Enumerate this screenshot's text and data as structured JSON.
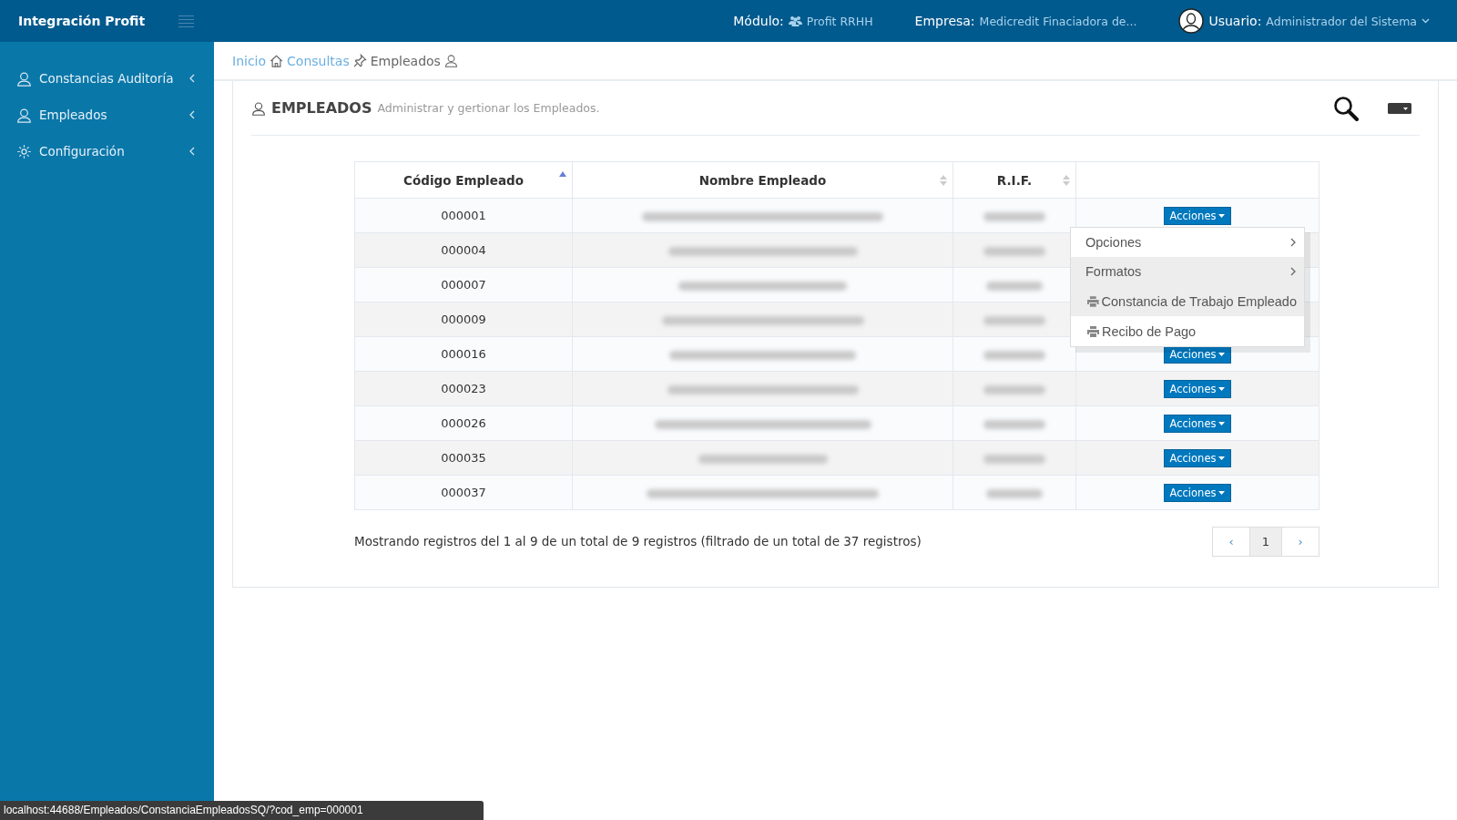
{
  "brand": "Integración Profit",
  "header": {
    "module_label": "Módulo:",
    "module_value": "Profit RRHH",
    "company_label": "Empresa:",
    "company_value": "Medicredit Finaciadora de...",
    "user_label": "Usuario:",
    "user_value": "Administrador del Sistema"
  },
  "sidebar": {
    "items": [
      {
        "label": "Constancias Auditoría",
        "expanded": false
      },
      {
        "label": "Empleados",
        "expanded": false
      },
      {
        "label": "Configuración",
        "expanded": false
      }
    ]
  },
  "breadcrumb": [
    {
      "label": "Inicio",
      "link": true
    },
    {
      "label": "Consultas",
      "link": true
    },
    {
      "label": "Empleados",
      "link": false
    }
  ],
  "panel": {
    "title": "EMPLEADOS",
    "subtitle": "Administrar y gertionar los Empleados."
  },
  "table": {
    "columns": [
      {
        "label": "Código Empleado",
        "sorted": true
      },
      {
        "label": "Nombre Empleado",
        "sorted": false
      },
      {
        "label": "R.I.F.",
        "sorted": false
      }
    ],
    "rows": [
      {
        "code": "000001",
        "actions": "Acciones"
      },
      {
        "code": "000004"
      },
      {
        "code": "000007"
      },
      {
        "code": "000009"
      },
      {
        "code": "000016",
        "actions": "Acciones"
      },
      {
        "code": "000023",
        "actions": "Acciones"
      },
      {
        "code": "000026",
        "actions": "Acciones"
      },
      {
        "code": "000035",
        "actions": "Acciones"
      },
      {
        "code": "000037",
        "actions": "Acciones"
      }
    ]
  },
  "actions_menu": {
    "items": [
      {
        "label": "Opciones",
        "kind": "submenu",
        "hovered": false
      },
      {
        "label": "Formatos",
        "kind": "submenu",
        "hovered": true
      },
      {
        "label": "Constancia de Trabajo Empleado",
        "kind": "print",
        "hovered": true
      },
      {
        "label": "Recibo de Pago",
        "kind": "print",
        "hovered": false
      }
    ]
  },
  "info": "Mostrando registros del 1 al 9 de un total de 9 registros (filtrado de un total de 37 registros)",
  "pagination": {
    "prev": "‹",
    "pages": [
      {
        "label": "1",
        "selected": true
      }
    ],
    "next": "›"
  },
  "status_url": "localhost:44688/Empleados/ConstanciaEmpleadosSQ/?cod_emp=000001"
}
